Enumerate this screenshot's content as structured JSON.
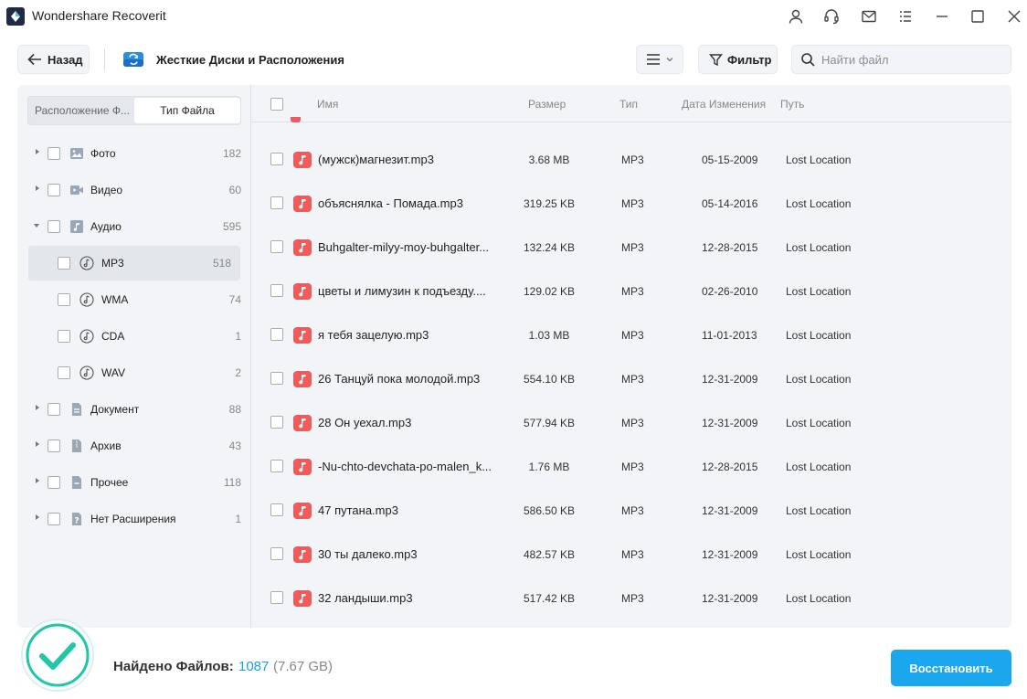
{
  "app": {
    "title": "Wondershare Recoverit"
  },
  "toolbar": {
    "back_label": "Назад",
    "location_title": "Жесткие Диски и Расположения",
    "filter_label": "Фильтр",
    "search_placeholder": "Найти файл"
  },
  "sidebar": {
    "tab_location": "Расположение Ф...",
    "tab_filetype": "Тип Файла",
    "items": [
      {
        "label": "Фото",
        "count": "182",
        "icon": "image-icon"
      },
      {
        "label": "Видео",
        "count": "60",
        "icon": "video-icon"
      },
      {
        "label": "Аудио",
        "count": "595",
        "icon": "audio-icon",
        "expanded": true
      },
      {
        "label": "MP3",
        "count": "518",
        "icon": "music-note-icon",
        "selected": true
      },
      {
        "label": "WMA",
        "count": "74",
        "icon": "music-note-icon"
      },
      {
        "label": "CDA",
        "count": "1",
        "icon": "music-note-icon"
      },
      {
        "label": "WAV",
        "count": "2",
        "icon": "music-note-icon"
      },
      {
        "label": "Документ",
        "count": "88",
        "icon": "document-icon"
      },
      {
        "label": "Архив",
        "count": "43",
        "icon": "archive-icon"
      },
      {
        "label": "Прочее",
        "count": "118",
        "icon": "other-file-icon"
      },
      {
        "label": "Нет Расширения",
        "count": "1",
        "icon": "unknown-file-icon"
      }
    ]
  },
  "table": {
    "headers": {
      "name": "Имя",
      "size": "Размер",
      "type": "Тип",
      "date": "Дата Изменения",
      "path": "Путь"
    },
    "rows": [
      {
        "name": "(мужск)магнезит.mp3",
        "size": "3.68 MB",
        "type": "MP3",
        "date": "05-15-2009",
        "path": "Lost Location"
      },
      {
        "name": "объяснялка - Помада.mp3",
        "size": "319.25 KB",
        "type": "MP3",
        "date": "05-14-2016",
        "path": "Lost Location"
      },
      {
        "name": "Buhgalter-milyy-moy-buhgalter...",
        "size": "132.24 KB",
        "type": "MP3",
        "date": "12-28-2015",
        "path": "Lost Location"
      },
      {
        "name": "цветы и лимузин к подъезду....",
        "size": "129.02 KB",
        "type": "MP3",
        "date": "02-26-2010",
        "path": "Lost Location"
      },
      {
        "name": "я тебя зацелую.mp3",
        "size": "1.03 MB",
        "type": "MP3",
        "date": "11-01-2013",
        "path": "Lost Location"
      },
      {
        "name": "26 Танцуй пока молодой.mp3",
        "size": "554.10 KB",
        "type": "MP3",
        "date": "12-31-2009",
        "path": "Lost Location"
      },
      {
        "name": "28 Он уехал.mp3",
        "size": "577.94 KB",
        "type": "MP3",
        "date": "12-31-2009",
        "path": "Lost Location"
      },
      {
        "name": "-Nu-chto-devchata-po-malen_k...",
        "size": "1.76 MB",
        "type": "MP3",
        "date": "12-28-2015",
        "path": "Lost Location"
      },
      {
        "name": "47 путана.mp3",
        "size": "586.50 KB",
        "type": "MP3",
        "date": "12-31-2009",
        "path": "Lost Location"
      },
      {
        "name": "30 ты далеко.mp3",
        "size": "482.57 KB",
        "type": "MP3",
        "date": "12-31-2009",
        "path": "Lost Location"
      },
      {
        "name": "32 ландыши.mp3",
        "size": "517.42 KB",
        "type": "MP3",
        "date": "12-31-2009",
        "path": "Lost Location"
      }
    ]
  },
  "footer": {
    "found_label": "Найдено Файлов:",
    "found_count": "1087",
    "found_size": "(7.67 GB)",
    "recover_label": "Восстановить"
  },
  "colors": {
    "accent": "#1ba7ee",
    "file_icon": "#ef5a5a",
    "check": "#1fc7a8"
  }
}
